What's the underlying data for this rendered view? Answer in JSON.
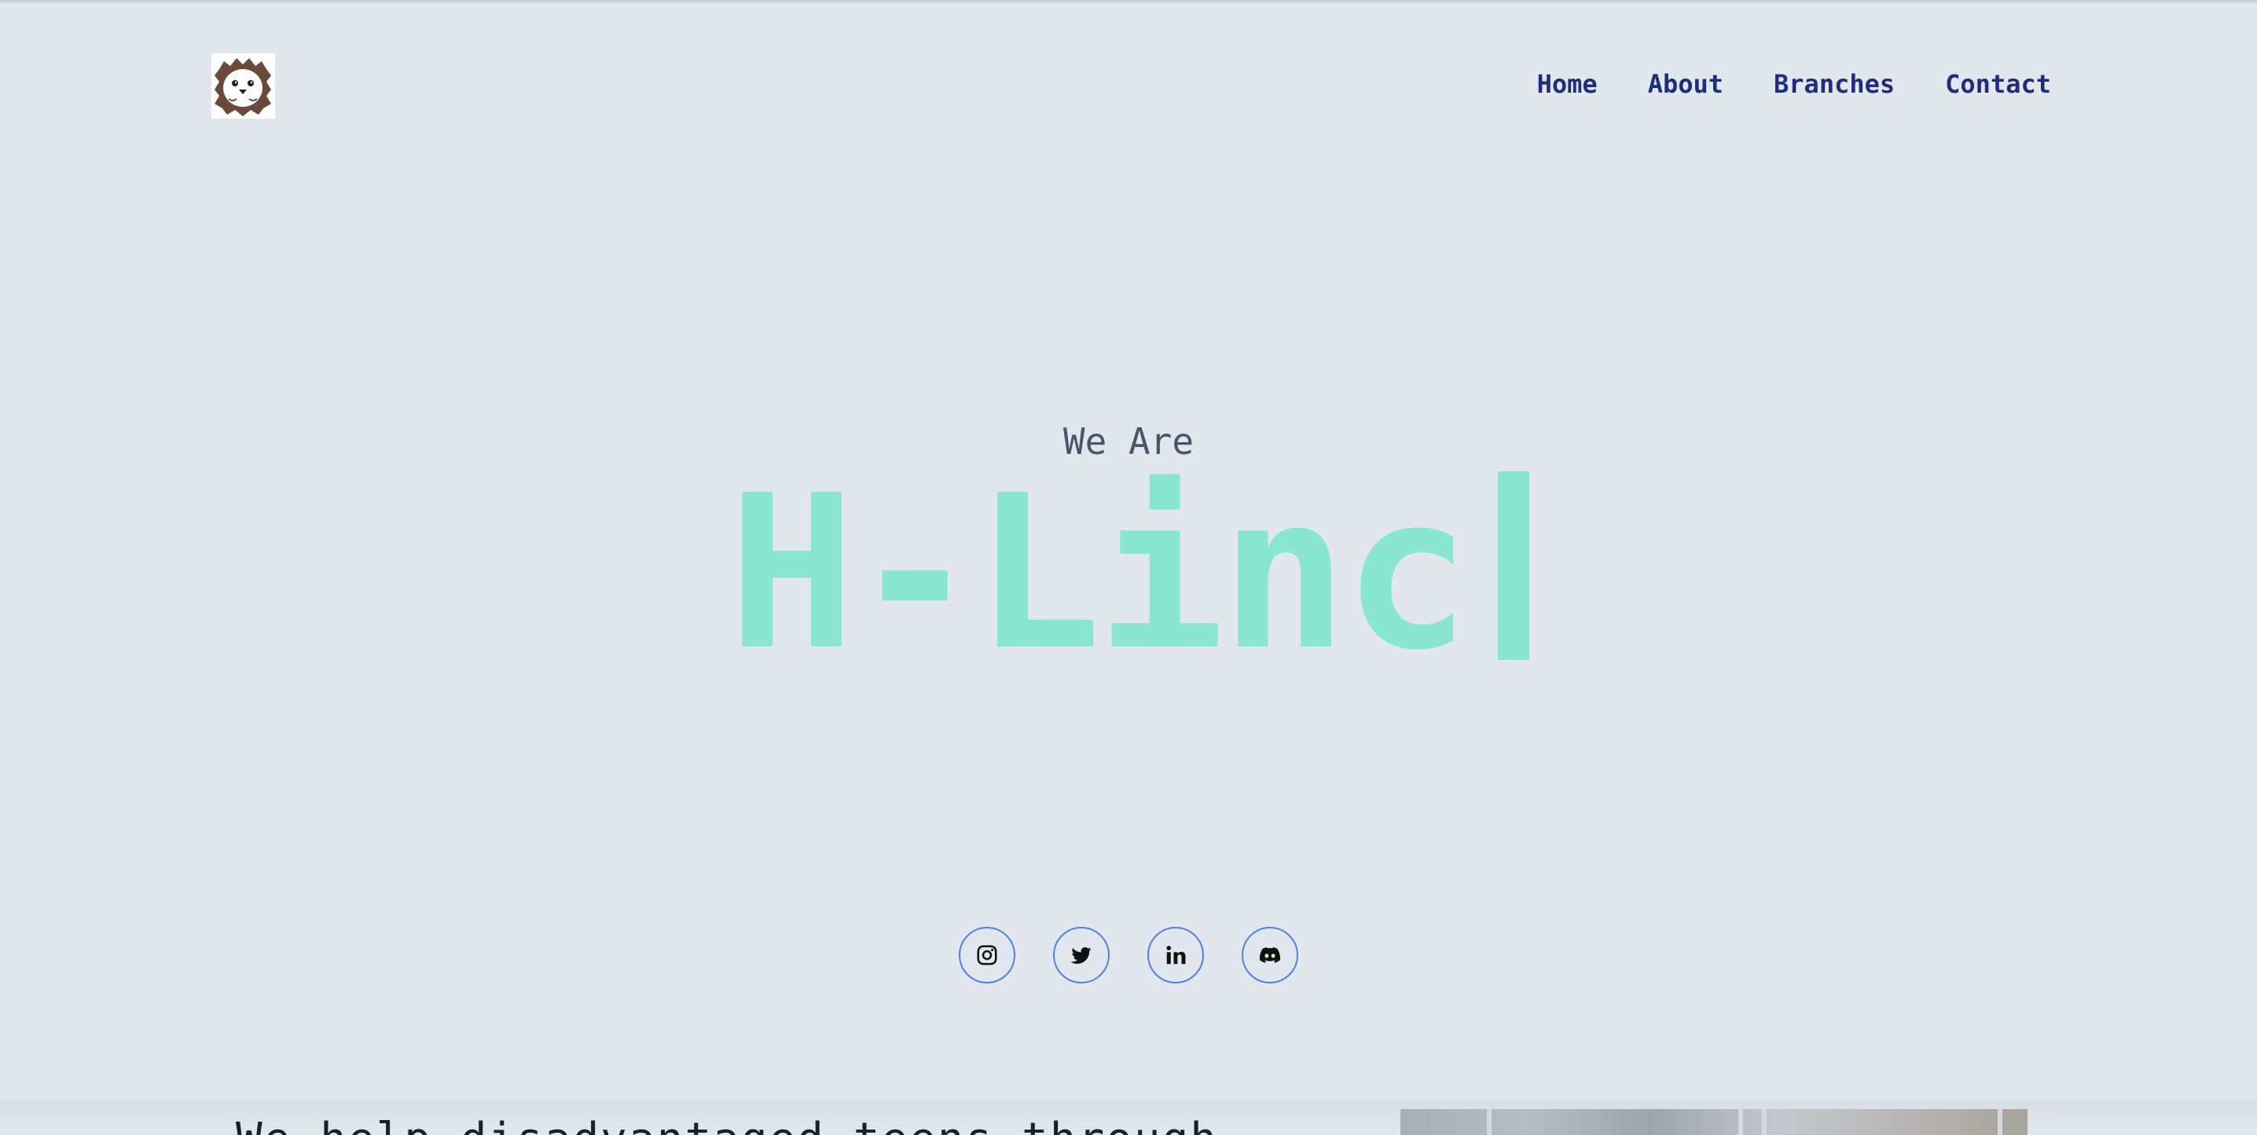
{
  "header": {
    "logo_alt": "hedgehog logo",
    "nav": [
      {
        "label": "Home"
      },
      {
        "label": "About"
      },
      {
        "label": "Branches"
      },
      {
        "label": "Contact"
      }
    ]
  },
  "hero": {
    "pre_title": "We Are",
    "title": "H-Linc"
  },
  "socials": [
    {
      "icon": "instagram-icon"
    },
    {
      "icon": "twitter-icon"
    },
    {
      "icon": "linkedin-icon"
    },
    {
      "icon": "discord-icon"
    }
  ],
  "bottom": {
    "text": "We help disadvantaged teens through"
  },
  "colors": {
    "background": "#e2e7ee",
    "nav_text": "#1e2e7a",
    "hero_accent": "#88e6d2",
    "social_border": "#4f82e8"
  }
}
